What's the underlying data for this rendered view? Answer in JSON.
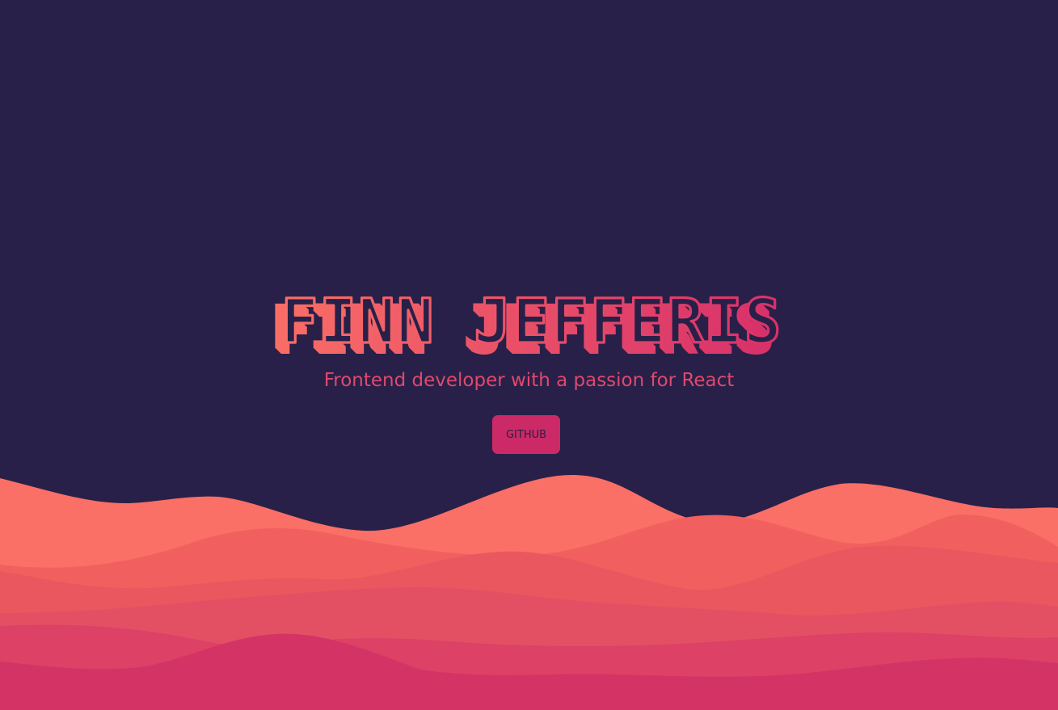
{
  "hero": {
    "name": "FINN JEFFERIS",
    "tagline": "Frontend developer with a passion for React",
    "github_label": "GITHUB"
  },
  "colors": {
    "background": "#282048",
    "title_gradient_start": "#f96e66",
    "title_gradient_end": "#d8306a",
    "tagline": "#e0486e",
    "button_bg": "#cc2a66",
    "button_text": "#2b1d44",
    "wave_layers": [
      "#fa6f66",
      "#f1605f",
      "#ea575e",
      "#e35064",
      "#dd4166",
      "#d33465"
    ]
  }
}
